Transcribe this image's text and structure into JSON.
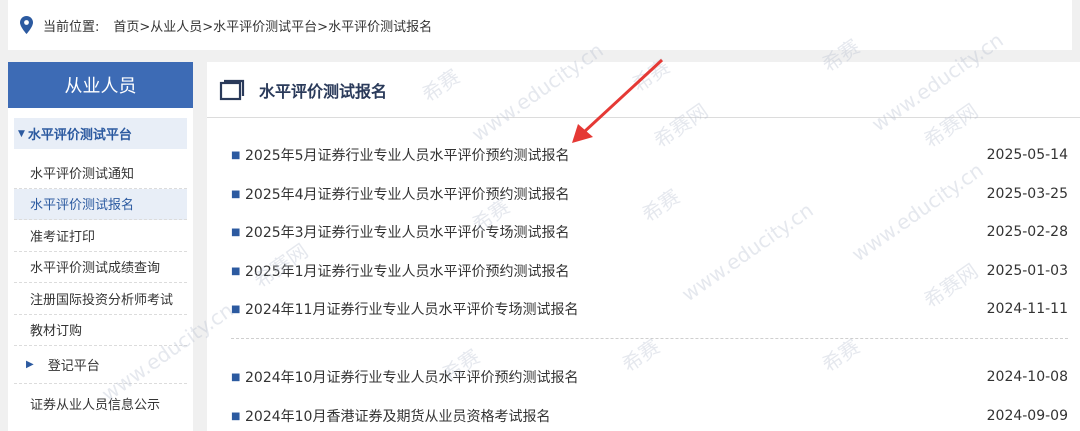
{
  "breadcrumb": {
    "label": "当前位置:",
    "path": "首页>从业人员>水平评价测试平台>水平评价测试报名"
  },
  "sidebar": {
    "header": "从业人员",
    "group": "水平评价测试平台",
    "items": [
      {
        "label": "水平评价测试通知",
        "active": false
      },
      {
        "label": "水平评价测试报名",
        "active": true
      },
      {
        "label": "准考证打印",
        "active": false
      },
      {
        "label": "水平评价测试成绩查询",
        "active": false
      },
      {
        "label": "注册国际投资分析师考试",
        "active": false
      },
      {
        "label": "教材订购",
        "active": false
      }
    ],
    "platform": "登记平台",
    "last": "证券从业人员信息公示"
  },
  "main": {
    "title": "水平评价测试报名",
    "news": [
      {
        "title": "2025年5月证券行业专业人员水平评价预约测试报名",
        "date": "2025-05-14"
      },
      {
        "title": "2025年4月证券行业专业人员水平评价预约测试报名",
        "date": "2025-03-25"
      },
      {
        "title": "2025年3月证券行业专业人员水平评价专场测试报名",
        "date": "2025-02-28"
      },
      {
        "title": "2025年1月证券行业专业人员水平评价预约测试报名",
        "date": "2025-01-03"
      },
      {
        "title": "2024年11月证券行业专业人员水平评价专场测试报名",
        "date": "2024-11-11"
      },
      {
        "title": "2024年10月证券行业专业人员水平评价预约测试报名",
        "date": "2024-10-08"
      },
      {
        "title": "2024年10月香港证券及期货从业员资格考试报名",
        "date": "2024-09-09"
      }
    ]
  },
  "watermark": {
    "brand": "希赛",
    "url": "www.educity.cn",
    "net": "希赛网"
  },
  "colors": {
    "accent": "#3d6bb5",
    "arrow": "#e53935",
    "active_bg": "#e8eef7"
  }
}
